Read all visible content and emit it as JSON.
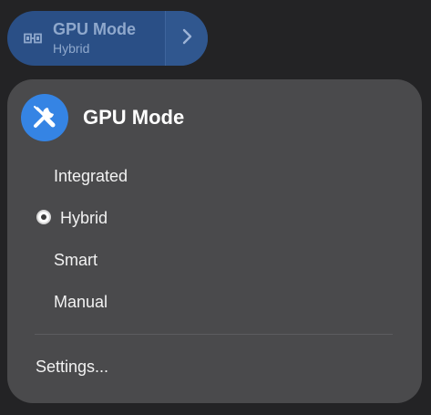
{
  "toggle": {
    "title": "GPU Mode",
    "subtitle": "Hybrid",
    "icon": "gpu-chip-icon",
    "arrow_icon": "chevron-right-icon",
    "bg_color": "#2a4f86"
  },
  "menu": {
    "header_icon": "wrench-screwdriver-icon",
    "title": "GPU Mode",
    "options": [
      {
        "label": "Integrated",
        "selected": false
      },
      {
        "label": "Hybrid",
        "selected": true
      },
      {
        "label": "Smart",
        "selected": false
      },
      {
        "label": "Manual",
        "selected": false
      }
    ],
    "settings_label": "Settings...",
    "accent_color": "#3584e4",
    "bg_color": "#4a4a4c"
  }
}
